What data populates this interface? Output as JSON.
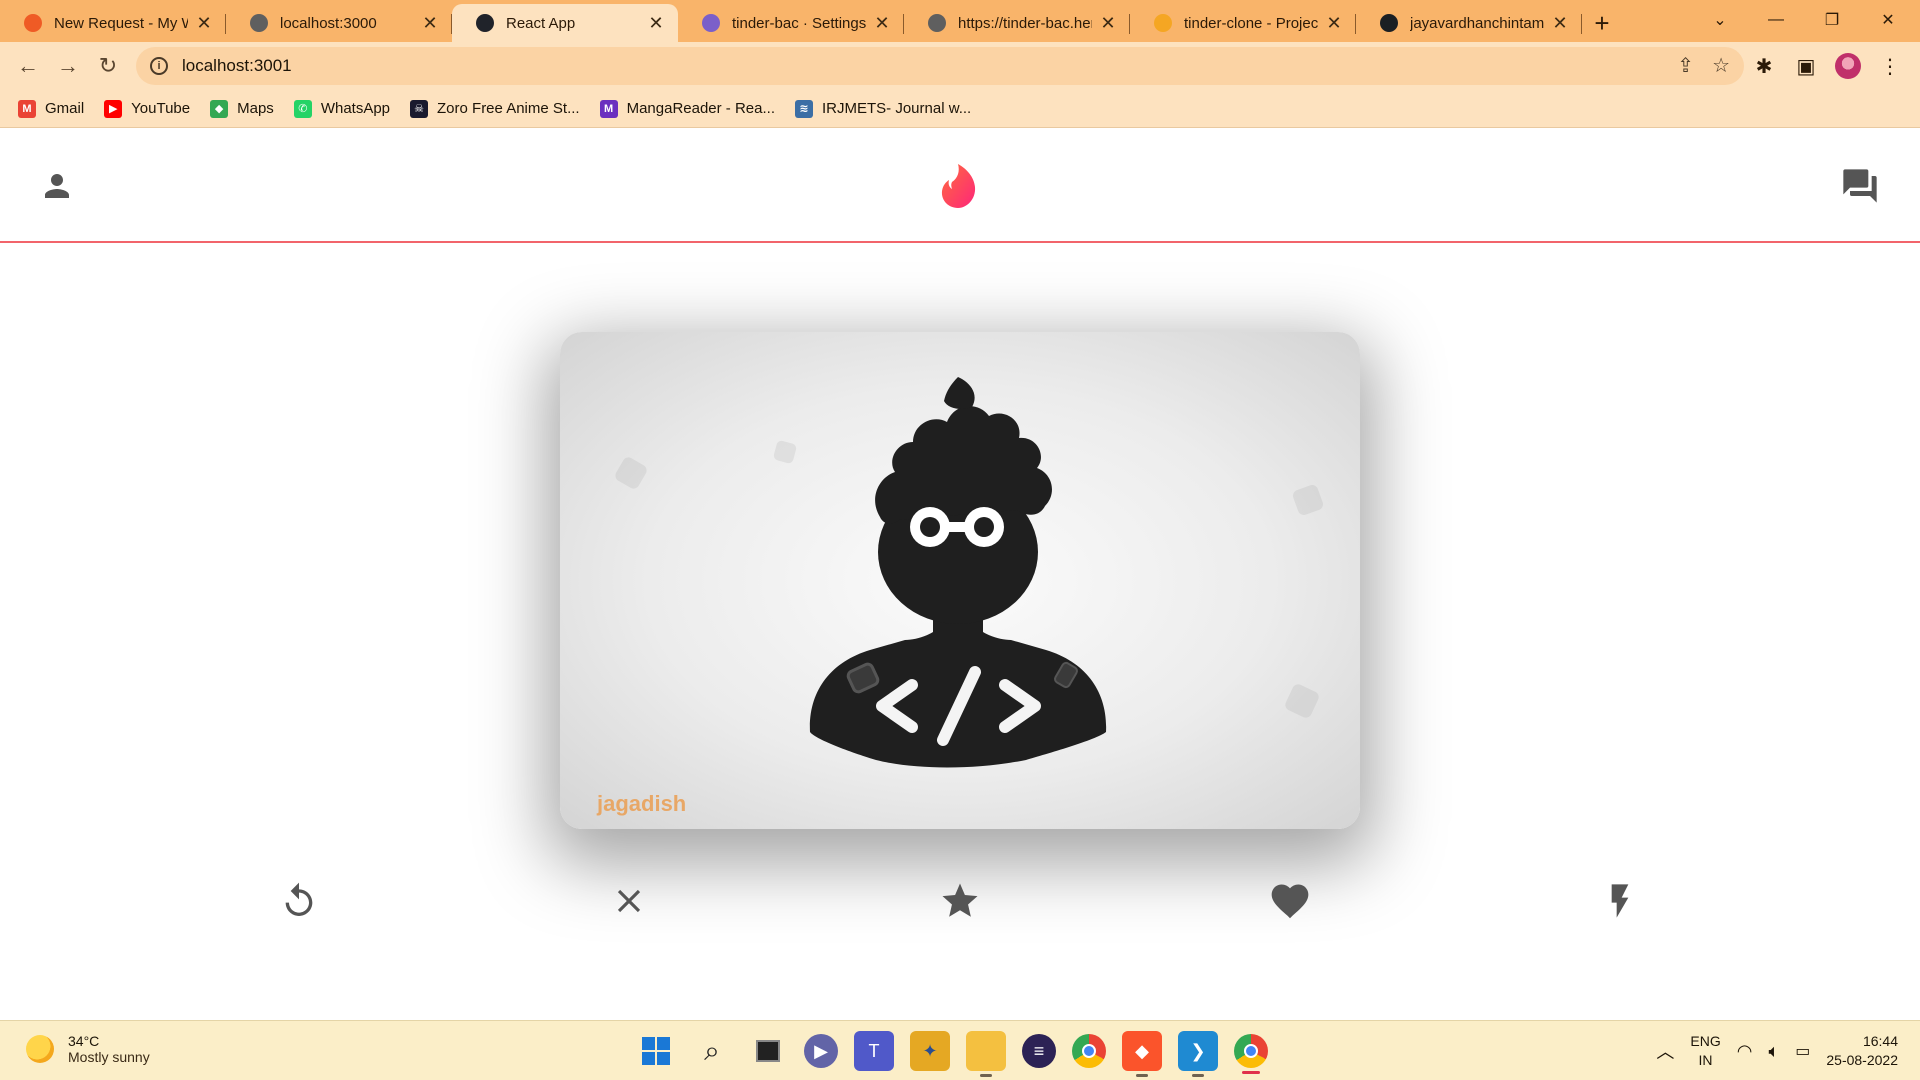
{
  "browser": {
    "tabs": [
      {
        "title": "New Request - My W",
        "favicon": "postman-icon",
        "color": "#ef5b25",
        "active": false
      },
      {
        "title": "localhost:3000",
        "favicon": "globe-icon",
        "color": "#5f5f5f",
        "active": false
      },
      {
        "title": "React App",
        "favicon": "react-icon",
        "color": "#20232a",
        "active": true
      },
      {
        "title": "tinder-bac · Settings |",
        "favicon": "heroku-icon",
        "color": "#7b5fc9",
        "active": false
      },
      {
        "title": "https://tinder-bac.her",
        "favicon": "globe-icon",
        "color": "#5f5f5f",
        "active": false
      },
      {
        "title": "tinder-clone - Project",
        "favicon": "firebase-icon",
        "color": "#f5a623",
        "active": false
      },
      {
        "title": "jayavardhanchintam/",
        "favicon": "github-icon",
        "color": "#1b1f23",
        "active": false
      }
    ],
    "new_tab_label": "+",
    "url": "localhost:3001",
    "bookmarks": [
      {
        "label": "Gmail",
        "icon": "gmail-icon",
        "color": "#ea4335",
        "glyph": "M"
      },
      {
        "label": "YouTube",
        "icon": "youtube-icon",
        "color": "#ff0000",
        "glyph": "▶"
      },
      {
        "label": "Maps",
        "icon": "maps-icon",
        "color": "#34a853",
        "glyph": "◆"
      },
      {
        "label": "WhatsApp",
        "icon": "whatsapp-icon",
        "color": "#25d366",
        "glyph": "✆"
      },
      {
        "label": "Zoro Free Anime St...",
        "icon": "zoro-icon",
        "color": "#1a1a2e",
        "glyph": "☠"
      },
      {
        "label": "MangaReader - Rea...",
        "icon": "mangareader-icon",
        "color": "#6b2fbf",
        "glyph": "M"
      },
      {
        "label": "IRJMETS- Journal w...",
        "icon": "irjmets-icon",
        "color": "#3b6ea5",
        "glyph": "≋"
      }
    ]
  },
  "app": {
    "brand_color": "#fe3c72",
    "card": {
      "name": "jagadish",
      "image": "developer-avatar"
    },
    "actions": [
      {
        "name": "undo-button",
        "icon": "replay-icon",
        "color": "#555555"
      },
      {
        "name": "nope-button",
        "icon": "close-icon",
        "color": "#555555"
      },
      {
        "name": "superlike-button",
        "icon": "star-icon",
        "color": "#555555"
      },
      {
        "name": "like-button",
        "icon": "heart-icon",
        "color": "#555555"
      },
      {
        "name": "boost-button",
        "icon": "flash-icon",
        "color": "#555555"
      }
    ]
  },
  "taskbar": {
    "temperature": "34°C",
    "weather": "Mostly sunny",
    "language_top": "ENG",
    "language_bottom": "IN",
    "time": "16:44",
    "date": "25-08-2022"
  }
}
